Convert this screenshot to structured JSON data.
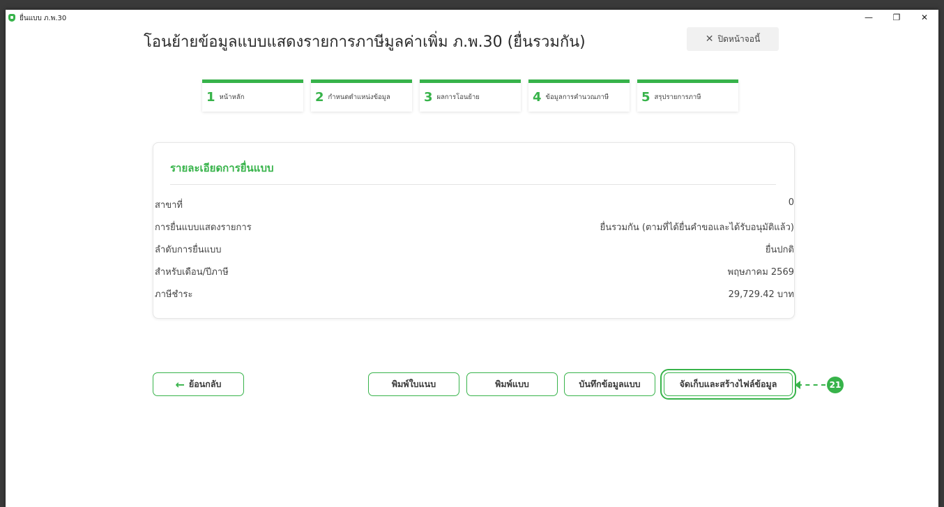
{
  "window": {
    "title": "ยื่นแบบ ภ.พ.30",
    "controls": {
      "minimize": "—",
      "restore": "❐",
      "close": "✕"
    }
  },
  "header": {
    "title": "โอนย้ายข้อมูลแบบแสดงรายการภาษีมูลค่าเพิ่ม ภ.พ.30 (ยื่นรวมกัน)",
    "close_page_label": "ปิดหน้าจอนี้",
    "close_icon": "✕"
  },
  "steps": [
    {
      "number": "1",
      "label": "หน้าหลัก"
    },
    {
      "number": "2",
      "label": "กำหนดตำแหน่งข้อมูล"
    },
    {
      "number": "3",
      "label": "ผลการโอนย้าย"
    },
    {
      "number": "4",
      "label": "ข้อมูลการคำนวณภาษี"
    },
    {
      "number": "5",
      "label": "สรุปรายการภาษี"
    }
  ],
  "details": {
    "title": "รายละเอียดการยื่นแบบ",
    "rows": [
      {
        "label": "สาขาที่",
        "value": "0"
      },
      {
        "label": "การยื่นแบบแสดงรายการ",
        "value": "ยื่นรวมกัน (ตามที่ได้ยื่นคำขอและได้รับอนุมัติแล้ว)"
      },
      {
        "label": "ลำดับการยื่นแบบ",
        "value": "ยื่นปกติ"
      },
      {
        "label": "สำหรับเดือน/ปีภาษี",
        "value": "พฤษภาคม 2569"
      },
      {
        "label": "ภาษีชำระ",
        "value": "29,729.42 บาท"
      }
    ]
  },
  "actions": {
    "back_arrow": "←",
    "back_label": "ย้อนกลับ",
    "print_cover_label": "พิมพ์ใบแนบ",
    "print_form_label": "พิมพ์แบบ",
    "save_label": "บันทึกข้อมูลแบบ",
    "create_file_label": "จัดเก็บและสร้างไฟล์ข้อมูล"
  },
  "callout": {
    "number": "21"
  },
  "colors": {
    "accent": "#37b34a"
  }
}
